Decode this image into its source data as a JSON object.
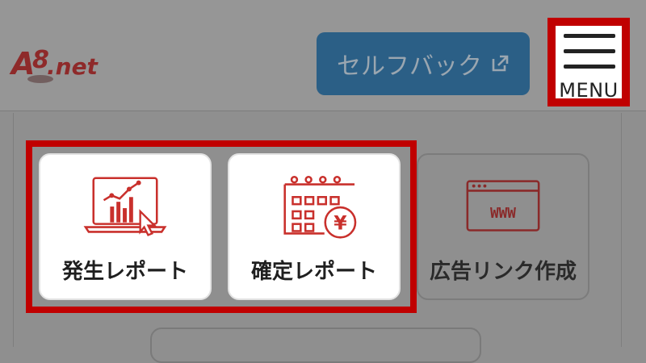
{
  "header": {
    "logo": {
      "text": "A8.net",
      "icon": "a8-logo"
    },
    "selfback_button": {
      "label": "セルフバック",
      "icon": "external-link-icon"
    },
    "menu_button": {
      "label": "MENU",
      "icon": "hamburger-icon"
    }
  },
  "cards": [
    {
      "label": "発生レポート",
      "icon": "laptop-chart-icon"
    },
    {
      "label": "確定レポート",
      "icon": "calendar-yen-icon"
    },
    {
      "label": "広告リンク作成",
      "icon": "browser-www-icon"
    }
  ],
  "colors": {
    "highlight": "#c00000",
    "icon_red": "#c9302c",
    "selfback_bg": "#2b5f86"
  }
}
